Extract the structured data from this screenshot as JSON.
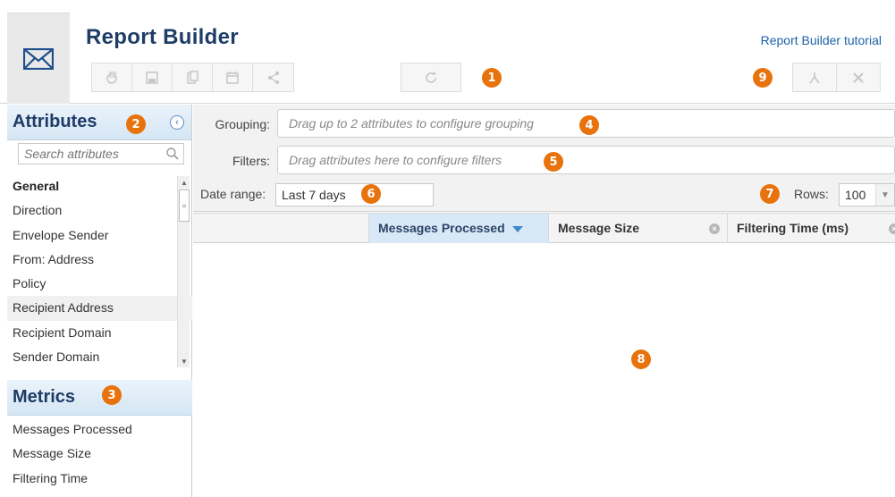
{
  "header": {
    "title": "Report Builder",
    "tutorial_link": "Report Builder tutorial",
    "toolbar_group1": [
      {
        "icon": "copy-report-icon"
      },
      {
        "icon": "save-icon"
      },
      {
        "icon": "clipboard-icon"
      },
      {
        "icon": "schedule-calendar-icon"
      },
      {
        "icon": "share-icon"
      }
    ],
    "toolbar_group2": [
      {
        "icon": "refresh-icon"
      }
    ],
    "export_group": [
      {
        "icon": "pdf-export-icon"
      },
      {
        "icon": "excel-export-icon"
      }
    ]
  },
  "badges": {
    "b1": "1",
    "b2": "2",
    "b3": "3",
    "b4": "4",
    "b5": "5",
    "b6": "6",
    "b7": "7",
    "b8": "8",
    "b9": "9"
  },
  "attributes": {
    "title": "Attributes",
    "search_placeholder": "Search attributes",
    "items": [
      {
        "label": "General",
        "bold": true
      },
      {
        "label": "Direction"
      },
      {
        "label": "Envelope Sender"
      },
      {
        "label": "From: Address"
      },
      {
        "label": "Policy"
      },
      {
        "label": "Recipient Address",
        "highlighted": true
      },
      {
        "label": "Recipient Domain"
      },
      {
        "label": "Sender Domain"
      }
    ]
  },
  "metrics": {
    "title": "Metrics",
    "items": [
      {
        "label": "Messages Processed"
      },
      {
        "label": "Message Size"
      },
      {
        "label": "Filtering Time"
      }
    ]
  },
  "filters": {
    "grouping_label": "Grouping:",
    "grouping_placeholder": "Drag up to 2 attributes to configure grouping",
    "filters_label": "Filters:",
    "filters_placeholder": "Drag attributes here to configure filters",
    "date_range_label": "Date range:",
    "date_range_value": "Last 7 days",
    "rows_label": "Rows:",
    "rows_value": "100"
  },
  "table": {
    "columns": [
      {
        "label": "Messages Processed",
        "sorted": "desc"
      },
      {
        "label": "Message Size"
      },
      {
        "label": "Filtering Time (ms)"
      }
    ]
  },
  "colors": {
    "accent_orange": "#e8720c",
    "title_navy": "#1f3c66",
    "link_blue": "#1a61a8",
    "sorted_header_bg": "#d9e8f6"
  }
}
